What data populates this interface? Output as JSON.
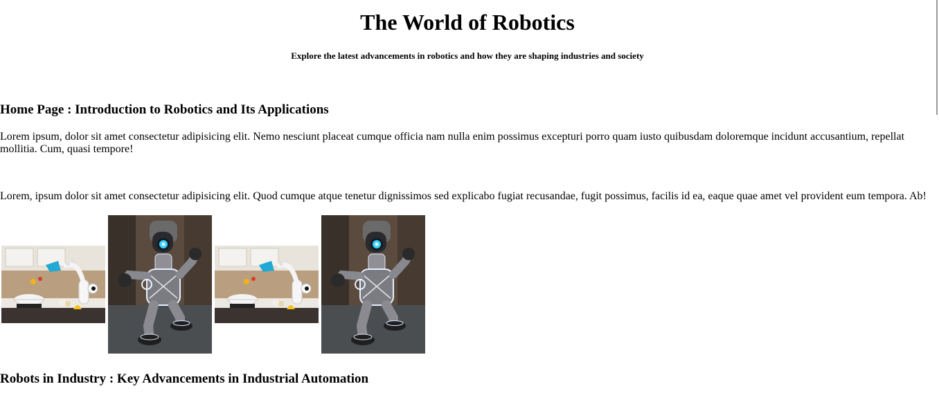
{
  "header": {
    "title": "The World of Robotics",
    "subtitle": "Explore the latest advancements in robotics and how they are shaping industries and society"
  },
  "sections": [
    {
      "heading": "Home Page : Introduction to Robotics and Its Applications",
      "paragraphs": [
        "Lorem ipsum, dolor sit amet consectetur adipisicing elit. Nemo nesciunt placeat cumque officia nam nulla enim possimus excepturi porro quam iusto quibusdam doloremque incidunt accusantium, repellat mollitia. Cum, quasi tempore!",
        "Lorem, ipsum dolor sit amet consectetur adipisicing elit. Quod cumque atque tenetur dignissimos sed explicabo fugiat recusandae, fugit possimus, facilis id ea, eaque quae amet vel provident eum tempora. Ab!"
      ]
    },
    {
      "heading": "Robots in Industry : Key Advancements in Industrial Automation"
    }
  ],
  "gallery": [
    {
      "kind": "kitchen-robot-photo"
    },
    {
      "kind": "standing-robot-photo"
    },
    {
      "kind": "kitchen-robot-photo"
    },
    {
      "kind": "standing-robot-photo"
    }
  ],
  "colors": {
    "text": "#000000",
    "background": "#ffffff",
    "robot_glow": "#3ad0ff"
  }
}
